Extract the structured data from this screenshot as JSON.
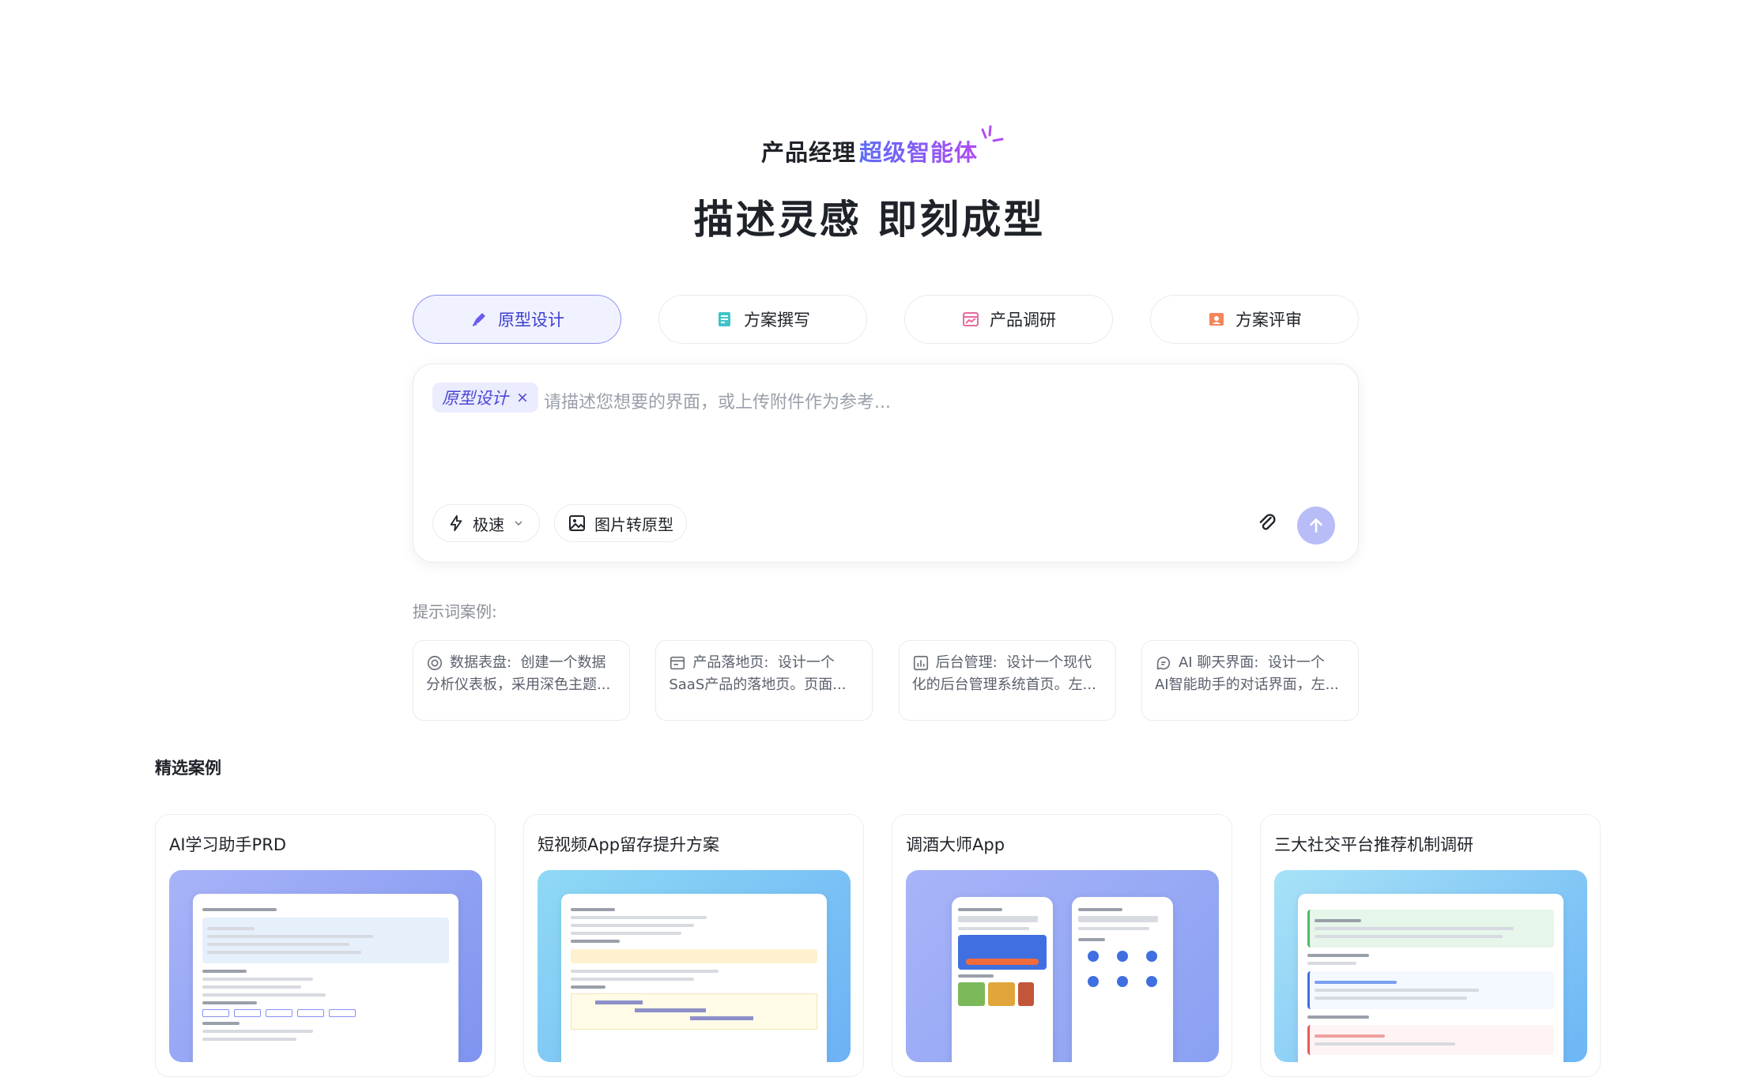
{
  "hero": {
    "subtitle_plain": "产品经理",
    "subtitle_accent": "超级智能体",
    "title": "描述灵感 即刻成型"
  },
  "tabs": [
    {
      "label": "原型设计",
      "icon": "pen-icon",
      "active": true
    },
    {
      "label": "方案撰写",
      "icon": "doc-edit-icon",
      "active": false
    },
    {
      "label": "产品调研",
      "icon": "chart-window-icon",
      "active": false
    },
    {
      "label": "方案评审",
      "icon": "review-person-icon",
      "active": false
    }
  ],
  "composer": {
    "chip_label": "原型设计",
    "chip_close": "×",
    "placeholder": "请描述您想要的界面，或上传附件作为参考...",
    "speed_label": "极速",
    "image_label": "图片转原型"
  },
  "hints": {
    "label": "提示词案例:",
    "items": [
      {
        "title": "数据表盘:",
        "line1": "创建一个数据",
        "line2": "分析仪表板，采用深色主题...",
        "icon": "gauge-icon"
      },
      {
        "title": "产品落地页:",
        "line1": "设计一个",
        "line2": "SaaS产品的落地页。页面...",
        "icon": "landing-page-icon"
      },
      {
        "title": "后台管理:",
        "line1": "设计一个现代",
        "line2": "化的后台管理系统首页。左...",
        "icon": "admin-chart-icon"
      },
      {
        "title": "AI 聊天界面:",
        "line1": "设计一个",
        "line2": "AI智能助手的对话界面，左...",
        "icon": "chat-ai-icon"
      }
    ]
  },
  "featured": {
    "title": "精选案例",
    "cards": [
      {
        "title": "AI学习助手PRD"
      },
      {
        "title": "短视频App留存提升方案"
      },
      {
        "title": "调酒大师App"
      },
      {
        "title": "三大社交平台推荐机制调研"
      }
    ]
  },
  "colors": {
    "accent": "#4c46d4",
    "active_tab_bg": "#f1f2ff",
    "send_button": "#b8bdf7"
  }
}
